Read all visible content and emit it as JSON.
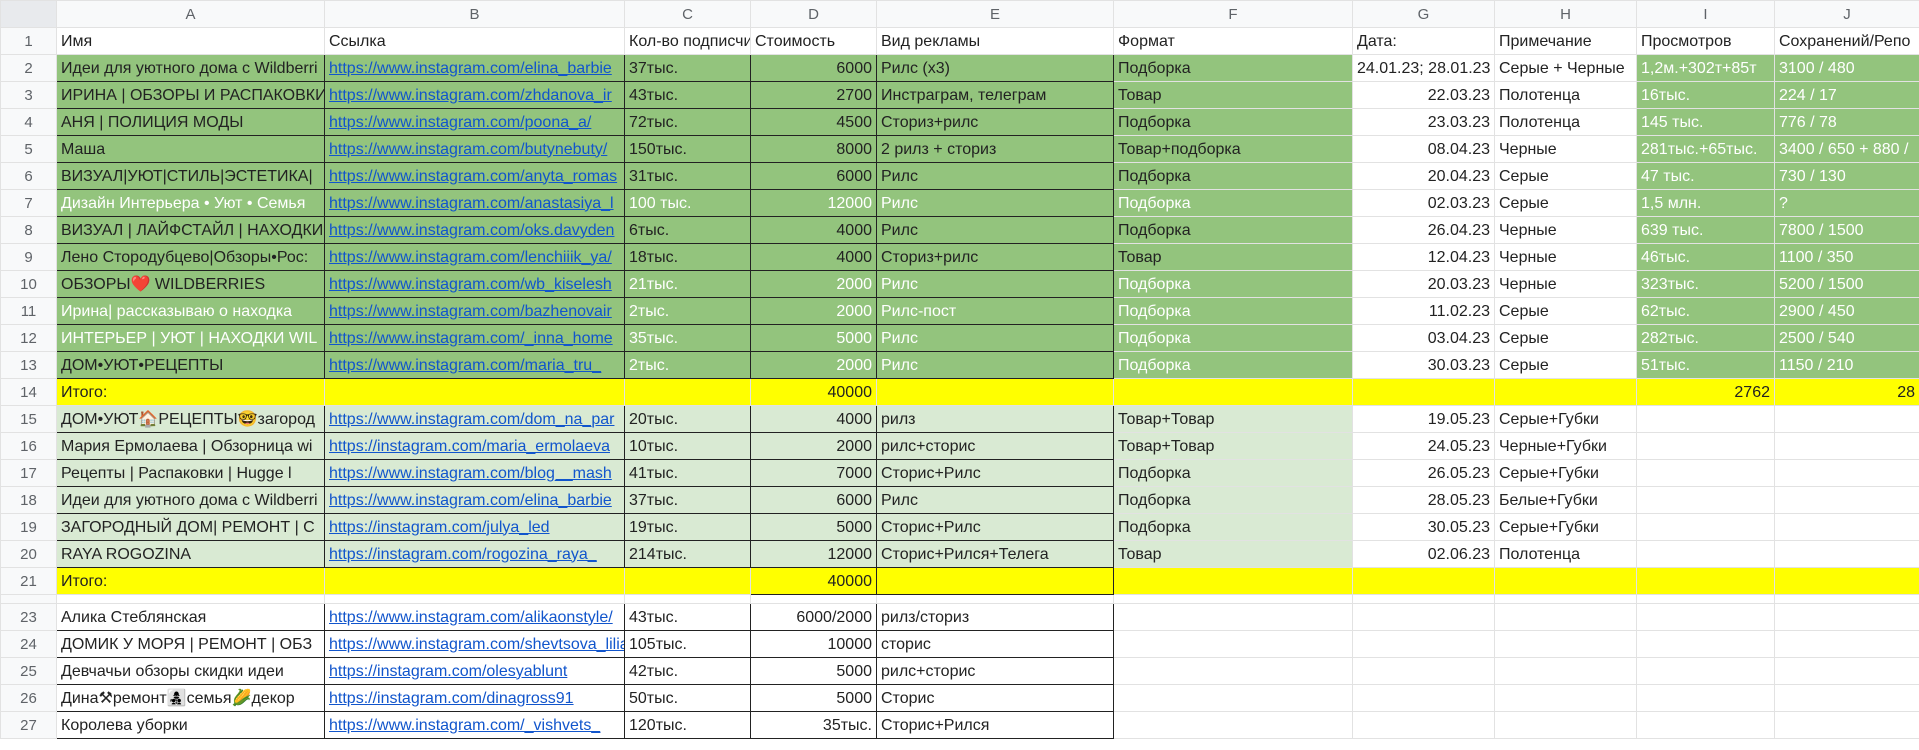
{
  "columns": [
    "A",
    "B",
    "C",
    "D",
    "E",
    "F",
    "G",
    "H",
    "I",
    "J"
  ],
  "header": {
    "row": "1",
    "cells": [
      "Имя",
      "Ссылка",
      "Кол-во подписчи",
      "Стоимость",
      "Вид рекламы",
      "Формат",
      "Дата:",
      "Примечание",
      "Просмотров",
      "Сохранений/Репо"
    ]
  },
  "rows": [
    {
      "num": "2",
      "name": "Идеи для уютного дома с Wildberri",
      "link": "https://www.instagram.com/elina_barbie",
      "subs": "37тыс.",
      "cost": "6000",
      "ad": "Рилс (x3)",
      "format": "Подборка",
      "date": "24.01.23; 28.01.23",
      "note": "Серые + Черные",
      "views": "1,2м.+302т+85т",
      "saves": "3100 / 480"
    },
    {
      "num": "3",
      "name": "ИРИНА | ОБЗОРЫ И РАСПАКОВКИ",
      "link": "https://www.instagram.com/zhdanova_ir",
      "subs": "43тыс.",
      "cost": "2700",
      "ad": "Инстраграм, телеграм",
      "format": "Товар",
      "date": "22.03.23",
      "note": "Полотенца",
      "views": "16тыс.",
      "saves": "224 / 17"
    },
    {
      "num": "4",
      "name": "АНЯ | ПОЛИЦИЯ МОДЫ",
      "link": "https://www.instagram.com/poona_a/",
      "subs": "72тыс.",
      "cost": "4500",
      "ad": "Сториз+рилс",
      "format": "Подборка",
      "date": "23.03.23",
      "note": "Полотенца",
      "views": "145 тыс.",
      "saves": "776 / 78"
    },
    {
      "num": "5",
      "name": "Маша",
      "link": "https://www.instagram.com/butynebuty/",
      "subs": "150тыс.",
      "cost": "8000",
      "ad": "2 рилз + сториз",
      "format": "Товар+подборка",
      "date": "08.04.23",
      "note": "Черные",
      "views": "281тыс.+65тыс.",
      "saves": "3400 / 650 + 880 /"
    },
    {
      "num": "6",
      "name": "ВИЗУАЛ|УЮТ|СТИЛЬ|ЭСТЕТИКА|",
      "link": "https://www.instagram.com/anyta_romas",
      "subs": "31тыс.",
      "cost": "6000",
      "ad": "Рилс",
      "format": "Подборка",
      "date": "20.04.23",
      "note": "Серые",
      "views": "47 тыс.",
      "saves": "730 / 130"
    },
    {
      "num": "7",
      "name": "Дизайн Интерьера • Уют • Семья",
      "link": "https://www.instagram.com/anastasiya_l",
      "subs": "100 тыс.",
      "cost": "12000",
      "ad": "Рилс",
      "format": "Подборка",
      "date": "02.03.23",
      "note": "Серые",
      "views": "1,5 млн.",
      "saves": "?"
    },
    {
      "num": "8",
      "name": "ВИЗУАЛ | ЛАЙФСТАЙЛ | НАХОДКИ",
      "link": "https://www.instagram.com/oks.davyden",
      "subs": "6тыс.",
      "cost": "4000",
      "ad": "Рилс",
      "format": "Подборка",
      "date": "26.04.23",
      "note": "Черные",
      "views": "639 тыс.",
      "saves": "7800 / 1500"
    },
    {
      "num": "9",
      "name": "Лено Стородубцево|Обзоры•Рос:",
      "link": "https://www.instagram.com/lenchiiik_ya/",
      "subs": "18тыс.",
      "cost": "4000",
      "ad": "Сториз+рилс",
      "format": "Товар",
      "date": "12.04.23",
      "note": "Черные",
      "views": "46тыс.",
      "saves": "1100 / 350"
    },
    {
      "num": "10",
      "name": "ОБЗОРЫ❤️ WILDBERRIES",
      "link": "https://www.instagram.com/wb_kiselesh",
      "subs": "21тыс.",
      "cost": "2000",
      "ad": "Рилс",
      "format": "Подборка",
      "date": "20.03.23",
      "note": "Черные",
      "views": "323тыс.",
      "saves": "5200 / 1500"
    },
    {
      "num": "11",
      "name": "Ирина| рассказываю о находка",
      "link": "https://www.instagram.com/bazhenovair",
      "subs": "2тыс.",
      "cost": "2000",
      "ad": "Рилс-пост",
      "format": "Подборка",
      "date": "11.02.23",
      "note": "Серые",
      "views": "62тыс.",
      "saves": "2900 / 450"
    },
    {
      "num": "12",
      "name": "ИНТЕРЬЕР | УЮТ | НАХОДКИ WIL",
      "link": "https://www.instagram.com/_inna_home",
      "subs": "35тыс.",
      "cost": "5000",
      "ad": "Рилс",
      "format": "Подборка",
      "date": "03.04.23",
      "note": "Серые",
      "views": "282тыс.",
      "saves": "2500 / 540"
    },
    {
      "num": "13",
      "name": "ДОМ•УЮТ•РЕЦЕПТЫ",
      "link": "https://www.instagram.com/maria_tru_",
      "subs": "2тыс.",
      "cost": "2000",
      "ad": "Рилс",
      "format": "Подборка",
      "date": "30.03.23",
      "note": "Серые",
      "views": "51тыс.",
      "saves": "1150 / 210"
    }
  ],
  "total1": {
    "num": "14",
    "label": "Итого:",
    "cost": "40000",
    "views": "2762",
    "saves": "28"
  },
  "rows2": [
    {
      "num": "15",
      "name": "ДОМ•УЮТ🏠РЕЦЕПТЫ🤓загород",
      "link": "https://www.instagram.com/dom_na_par",
      "subs": "20тыс.",
      "cost": "4000",
      "ad": "рилз",
      "format": "Товар+Товар",
      "date": "19.05.23",
      "note": "Серые+Губки"
    },
    {
      "num": "16",
      "name": "Мария Ермолаева | Обзорница wi",
      "link": "https://instagram.com/maria_ermolaeva",
      "subs": "10тыс.",
      "cost": "2000",
      "ad": "рилс+сторис",
      "format": "Товар+Товар",
      "date": "24.05.23",
      "note": "Черные+Губки"
    },
    {
      "num": "17",
      "name": "Рецепты | Распаковки | Hugge l",
      "link": "https://www.instagram.com/blog__mash",
      "subs": "41тыс.",
      "cost": "7000",
      "ad": "Сторис+Рилс",
      "format": "Подборка",
      "date": "26.05.23",
      "note": "Серые+Губки"
    },
    {
      "num": "18",
      "name": "Идеи для уютного дома с Wildberri",
      "link": "https://www.instagram.com/elina_barbie",
      "subs": "37тыс.",
      "cost": "6000",
      "ad": "Рилс",
      "format": "Подборка",
      "date": "28.05.23",
      "note": "Белые+Губки"
    },
    {
      "num": "19",
      "name": "ЗАГОРОДНЫЙ ДОМ| РЕМОНТ | С",
      "link": "https://instagram.com/julya_led",
      "subs": "19тыс.",
      "cost": "5000",
      "ad": "Сторис+Рилс",
      "format": "Подборка",
      "date": "30.05.23",
      "note": "Серые+Губки"
    },
    {
      "num": "20",
      "name": "RAYA ROGOZINA",
      "link": "https://instagram.com/rogozina_raya_",
      "subs": "214тыс.",
      "cost": "12000",
      "ad": "Сторис+Рился+Телега",
      "format": "Товар",
      "date": "02.06.23",
      "note": "Полотенца"
    }
  ],
  "total2": {
    "num": "21",
    "label": "Итого:",
    "cost": "40000"
  },
  "rows3": [
    {
      "num": "23",
      "name": "Алика Стеблянская",
      "link": "https://www.instagram.com/alikaonstyle/",
      "subs": "43тыс.",
      "cost": "6000/2000",
      "ad": "рилз/сториз"
    },
    {
      "num": "24",
      "name": "ДОМИК У МОРЯ | РЕМОНТ | ОБЗ",
      "link": "https://www.instagram.com/shevtsova_lilia",
      "subs": "105тыс.",
      "cost": "10000",
      "ad": "сторис"
    },
    {
      "num": "25",
      "name": "Девчачьи обзоры скидки идеи",
      "link": "https://instagram.com/olesyablunt",
      "subs": "42тыс.",
      "cost": "5000",
      "ad": "рилс+сторис"
    },
    {
      "num": "26",
      "name": "Дина⚒ремонт👩‍👧‍👦семья🌽декор",
      "link": "https://instagram.com/dinagross91",
      "subs": "50тыс.",
      "cost": "5000",
      "ad": "Сторис"
    },
    {
      "num": "27",
      "name": "Королева уборки",
      "link": "https://www.instagram.com/_vishvets_",
      "subs": "120тыс.",
      "cost": "35тыс.",
      "ad": "Сторис+Рился"
    }
  ]
}
